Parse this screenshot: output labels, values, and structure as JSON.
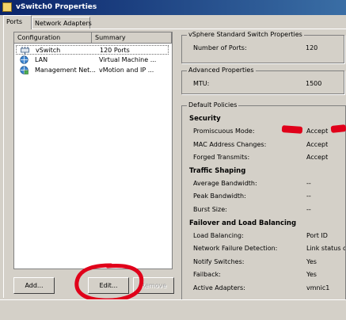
{
  "window": {
    "title": "vSwitch0 Properties"
  },
  "tabs": [
    {
      "label": "Ports",
      "active": true
    },
    {
      "label": "Network Adapters",
      "active": false
    }
  ],
  "list": {
    "columns": [
      "Configuration",
      "Summary"
    ],
    "rows": [
      {
        "icon": "vswitch-icon",
        "name": "vSwitch",
        "summary": "120 Ports",
        "selected": true
      },
      {
        "icon": "network-globe-icon",
        "name": "LAN",
        "summary": "Virtual Machine ..."
      },
      {
        "icon": "vmkernel-globe-icon",
        "name": "Management Net...",
        "summary": "vMotion and IP ..."
      }
    ]
  },
  "buttons": {
    "add": "Add...",
    "edit": "Edit...",
    "remove": "Remove"
  },
  "switch_props": {
    "title": "vSphere Standard Switch Properties",
    "ports_label": "Number of Ports:",
    "ports_value": "120"
  },
  "advanced": {
    "title": "Advanced Properties",
    "mtu_label": "MTU:",
    "mtu_value": "1500"
  },
  "policies": {
    "title": "Default Policies",
    "security": {
      "title": "Security",
      "promiscuous_label": "Promiscuous Mode:",
      "promiscuous_value": "Accept",
      "mac_label": "MAC Address Changes:",
      "mac_value": "Accept",
      "forged_label": "Forged Transmits:",
      "forged_value": "Accept"
    },
    "shaping": {
      "title": "Traffic Shaping",
      "avg_label": "Average Bandwidth:",
      "avg_value": "--",
      "peak_label": "Peak Bandwidth:",
      "peak_value": "--",
      "burst_label": "Burst Size:",
      "burst_value": "--"
    },
    "failover": {
      "title": "Failover and Load Balancing",
      "lb_label": "Load Balancing:",
      "lb_value": "Port ID",
      "nfd_label": "Network Failure Detection:",
      "nfd_value": "Link status on",
      "notify_label": "Notify Switches:",
      "notify_value": "Yes",
      "failback_label": "Failback:",
      "failback_value": "Yes",
      "active_label": "Active Adapters:",
      "active_value": "vmnic1"
    }
  },
  "colors": {
    "title_bar": "#0a246a",
    "annotation_red": "#e0001a"
  }
}
